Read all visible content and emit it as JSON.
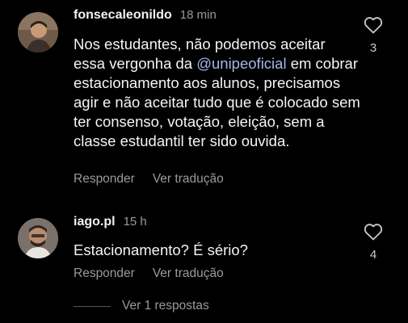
{
  "comments": [
    {
      "username": "fonsecaleonildo",
      "time": "18 min",
      "text_before": "Nos estudantes, não podemos aceitar essa vergonha da ",
      "mention": "@unipeoficial",
      "text_after": " em cobrar estacionamento aos alunos, precisamos agir e não aceitar tudo que é colocado sem ter consenso, votação, eleição, sem a classe estudantil ter sido ouvida.",
      "reply_label": "Responder",
      "translate_label": "Ver tradução",
      "like_count": "3"
    },
    {
      "username": "iago.pl",
      "time": "15 h",
      "text": "Estacionamento? É sério?",
      "reply_label": "Responder",
      "translate_label": "Ver tradução",
      "like_count": "4"
    }
  ],
  "replies": {
    "label": "Ver 1 respostas"
  },
  "colors": {
    "background": "#000000",
    "mention": "#a7b6e6",
    "muted": "#9a9a9a"
  },
  "icons": {
    "like": "heart-outline-icon"
  }
}
